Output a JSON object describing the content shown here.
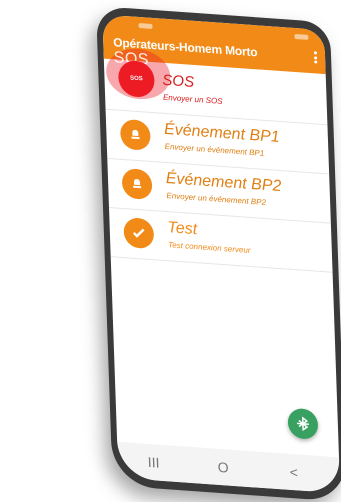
{
  "app": {
    "title": "Opérateurs-Homem Morto",
    "fab_icon": "bluetooth-off-icon",
    "accent": "#f28a17",
    "sos_color": "#ec1b24",
    "fab_color": "#38a060"
  },
  "sos_overlay": {
    "halo_text": "SOS",
    "badge_text": "SOS"
  },
  "items": [
    {
      "title": "SOS",
      "subtitle": "Envoyer un SOS",
      "icon": "sos-badge"
    },
    {
      "title": "Événement BP1",
      "subtitle": "Envoyer un événement BP1",
      "icon": "alarm-bell-icon"
    },
    {
      "title": "Événement BP2",
      "subtitle": "Envoyer un événement BP2",
      "icon": "alarm-bell-icon"
    },
    {
      "title": "Test",
      "subtitle": "Test connexion serveur",
      "icon": "check-icon"
    }
  ],
  "nav": {
    "recent": "III",
    "home": "O",
    "back": "<"
  }
}
